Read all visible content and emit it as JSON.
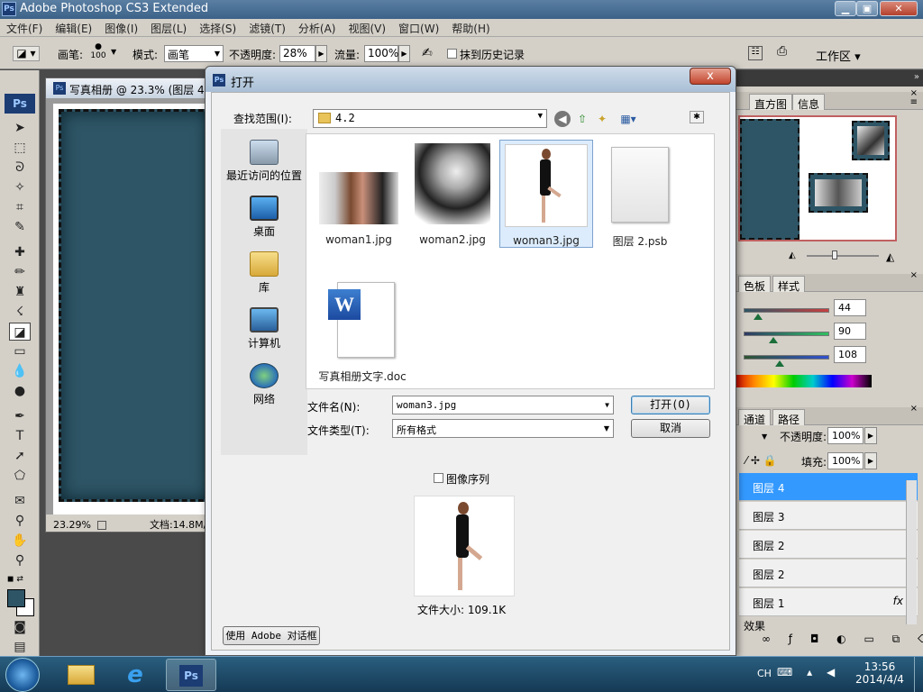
{
  "app": {
    "title": "Adobe Photoshop CS3 Extended",
    "icon_text": "Ps"
  },
  "menu": [
    "文件(F)",
    "编辑(E)",
    "图像(I)",
    "图层(L)",
    "选择(S)",
    "滤镜(T)",
    "分析(A)",
    "视图(V)",
    "窗口(W)",
    "帮助(H)"
  ],
  "options": {
    "brush_label": "画笔:",
    "brush_size": "100",
    "mode_label": "模式:",
    "mode_value": "画笔",
    "opacity_label": "不透明度:",
    "opacity_value": "28%",
    "flow_label": "流量:",
    "flow_value": "100%",
    "history_label": "抹到历史记录",
    "workspace_label": "工作区"
  },
  "document": {
    "title": "写真相册 @ 23.3% (图层 4",
    "zoom": "23.29%",
    "doc_info": "文档:14.8M/"
  },
  "right": {
    "nav_tabs": [
      "直方图",
      "信息"
    ],
    "color_tabs": [
      "色板",
      "样式"
    ],
    "color_values": [
      "44",
      "90",
      "108"
    ],
    "layer_tabs": [
      "通道",
      "路径"
    ],
    "opacity_label": "不透明度:",
    "opacity_value": "100%",
    "fill_label": "填充:",
    "fill_value": "100%",
    "layers": [
      "图层 4",
      "图层 3",
      "图层 2",
      "图层 2",
      "图层 1"
    ],
    "effects_label": "效果",
    "fx_label": "fx"
  },
  "dialog": {
    "title": "打开",
    "close_label": "x",
    "lookin_label": "查找范围(I):",
    "lookin_value": "4.2",
    "places": [
      "最近访问的位置",
      "桌面",
      "库",
      "计算机",
      "网络"
    ],
    "files": [
      "woman1.jpg",
      "woman2.jpg",
      "woman3.jpg",
      "图层 2.psb",
      "写真相册文字.doc"
    ],
    "filename_label": "文件名(N):",
    "filename_value": "woman3.jpg",
    "filetype_label": "文件类型(T):",
    "filetype_value": "所有格式",
    "open_button": "打开(O)",
    "cancel_button": "取消",
    "sequence_label": "图像序列",
    "file_size": "文件大小: 109.1K",
    "adobe_dialog_button": "使用 Adobe 对话框"
  },
  "taskbar": {
    "lang": "CH",
    "time": "13:56",
    "date": "2014/4/4"
  },
  "colors": {
    "canvas": "#2e5565",
    "selection": "#3399ff",
    "title_bar": "#4a6f96"
  }
}
